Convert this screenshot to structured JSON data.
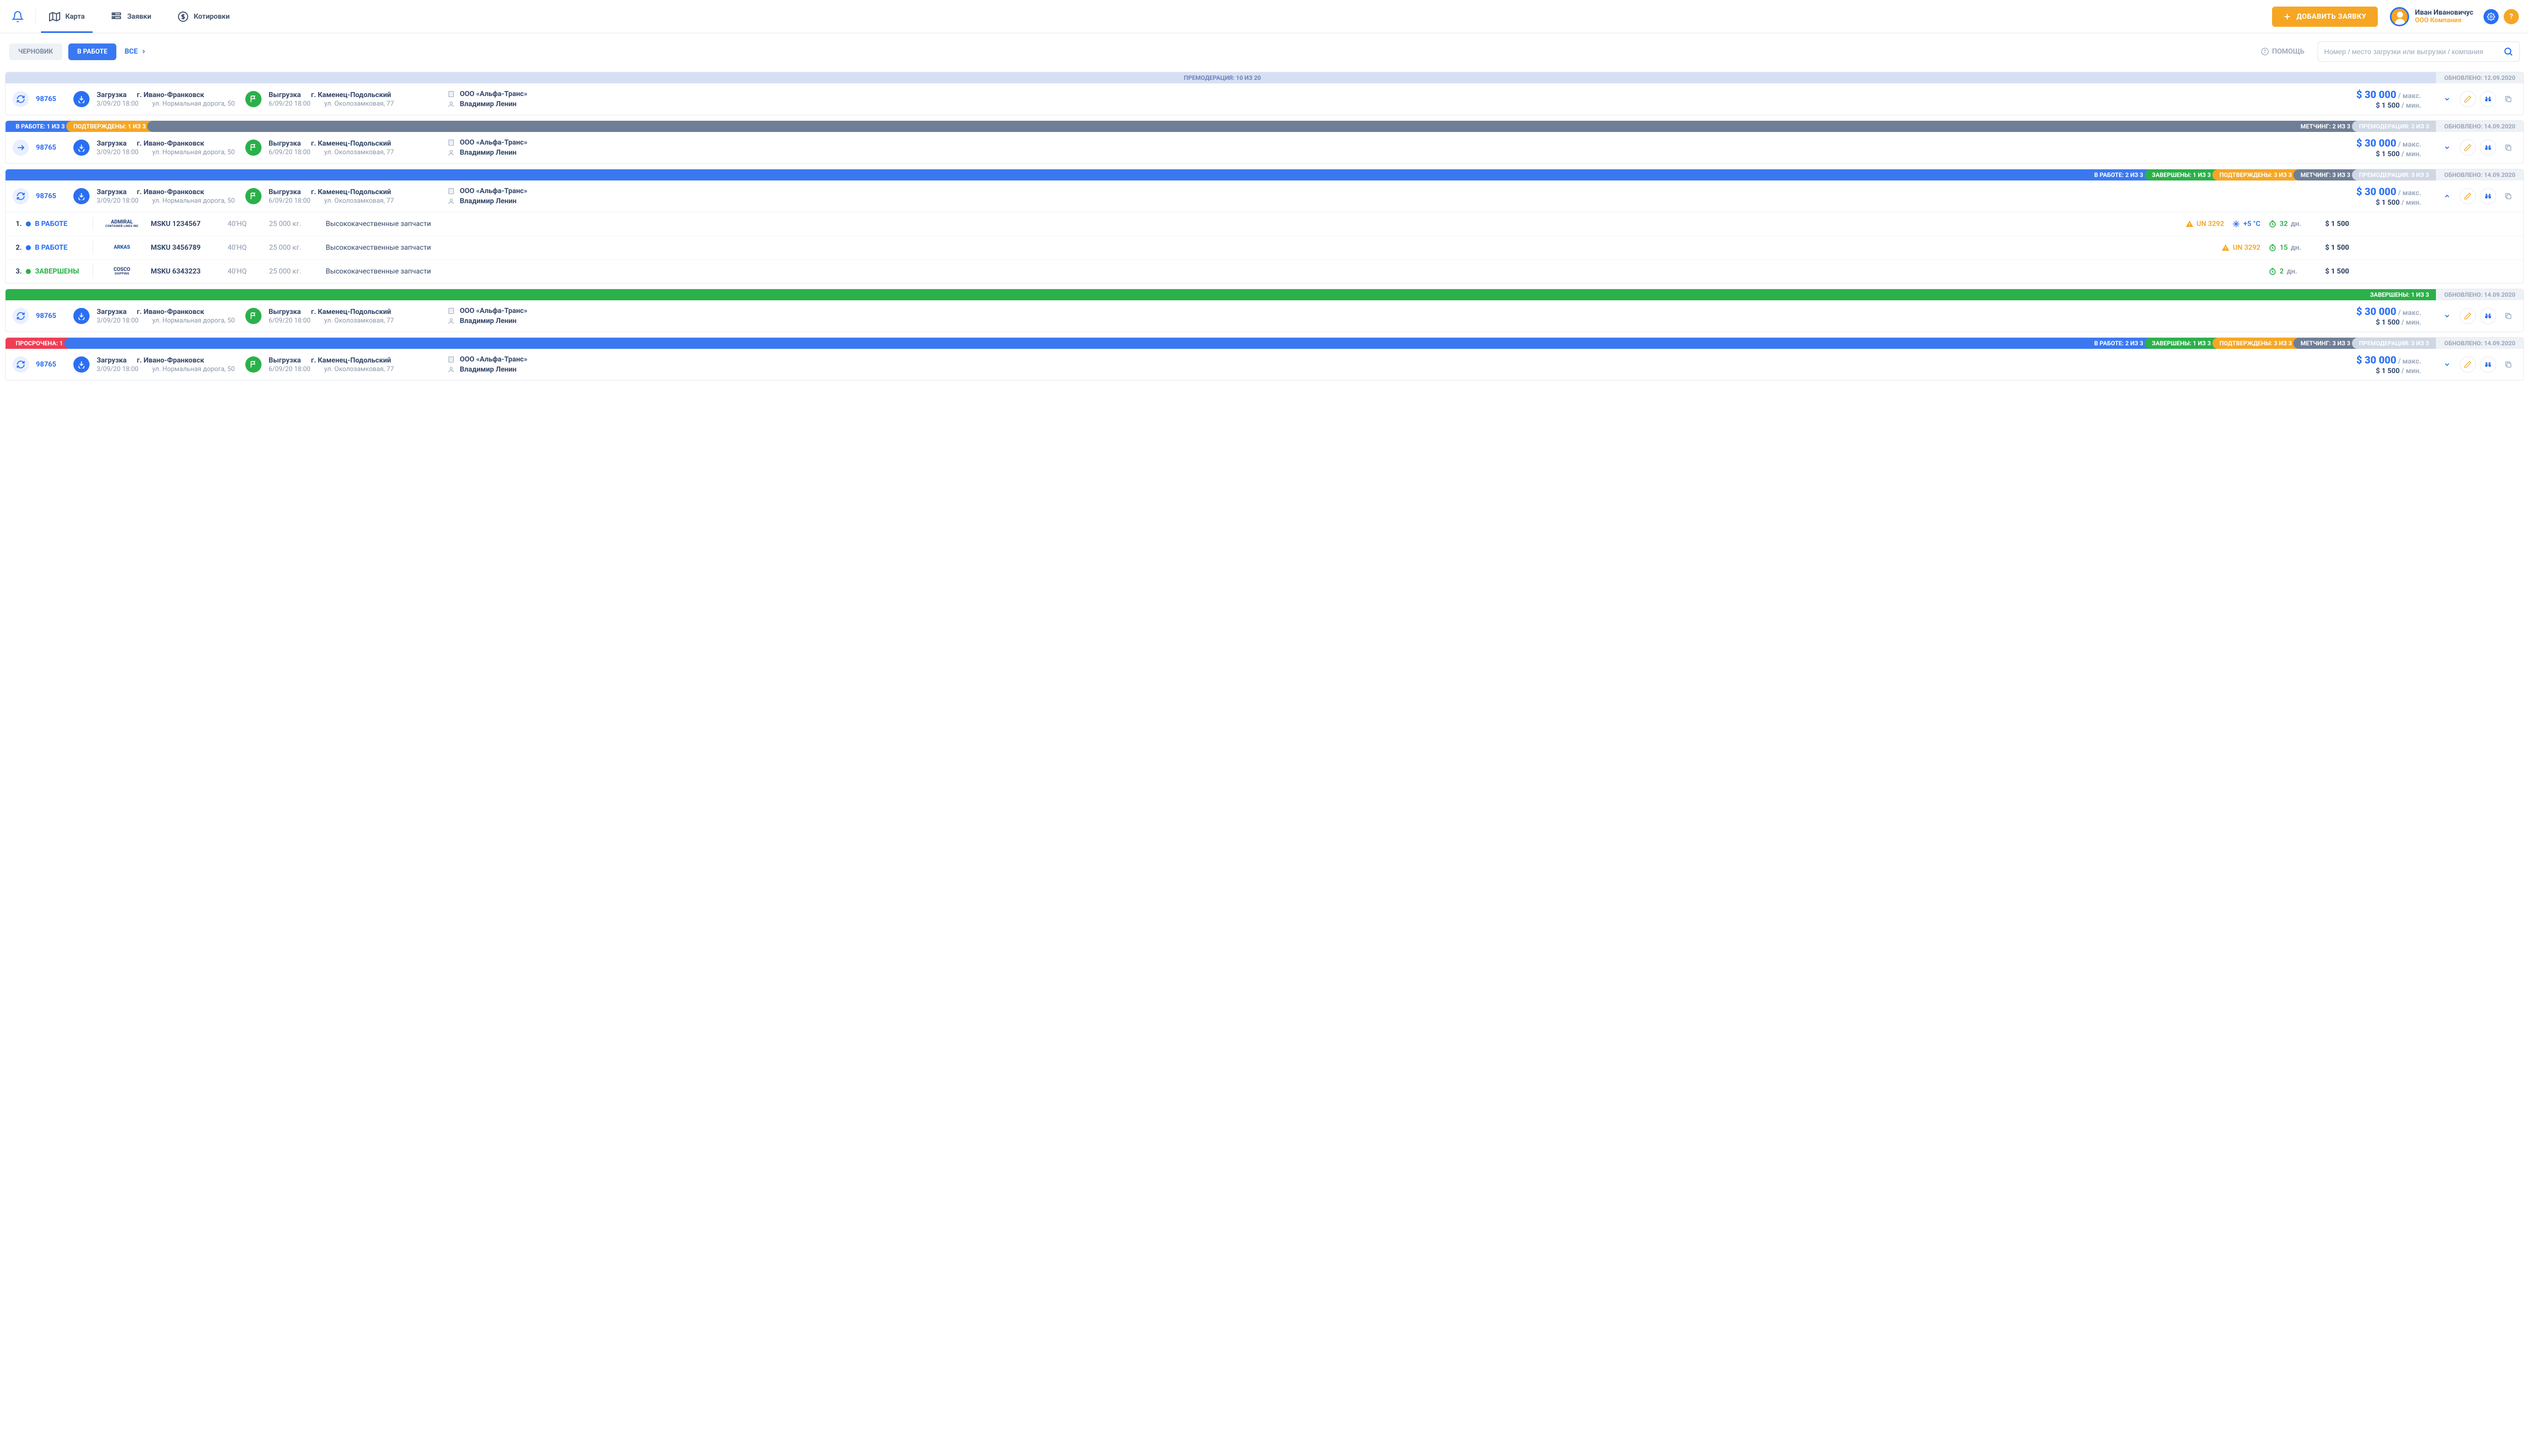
{
  "header": {
    "nav": {
      "map": "Карта",
      "orders": "Заявки",
      "quotes": "Котировки"
    },
    "add_btn": "ДОБАВИТЬ ЗАЯВКУ",
    "user": {
      "name": "Иван Ивановичус",
      "company": "ООО Компания"
    },
    "help_q": "?"
  },
  "filters": {
    "draft": "ЧЕРНОВИК",
    "inwork": "В РАБОТЕ",
    "all": "ВСЕ",
    "help": "ПОМОЩЬ",
    "search_placeholder": "Номер / место загрузки или выгрузки / компания"
  },
  "labels": {
    "load": "Загрузка",
    "unload": "Выгрузка",
    "max": "/ макс.",
    "min": "/ мин.",
    "updated_prefix": "ОБНОВЛЕНО: "
  },
  "common": {
    "id": "98765",
    "load_city": "г. Ивано-Франковск",
    "load_dt": "3/09/20  18:00",
    "load_addr": "ул. Нормальная дорога, 50",
    "unload_city": "г. Каменец-Подольский",
    "unload_dt": "6/09/20  18:00",
    "unload_addr": "ул. Околозамковая, 77",
    "company": "ООО «Альфа-Транс»",
    "person": "Владимир Ленин",
    "price_max": "$ 30 000",
    "price_min": "$ 1 500"
  },
  "rows": [
    {
      "segments": [
        {
          "cls": "c-lav fill center",
          "text": "ПРЕМОДЕРАЦИЯ: 10 ИЗ 20"
        },
        {
          "cls": "updated",
          "text": "ОБНОВЛЕНО: 12.09.2020"
        }
      ],
      "icon": "refresh",
      "expanded": false
    },
    {
      "segments": [
        {
          "cls": "c-blue",
          "text": "В РАБОТЕ: 1 ИЗ 3"
        },
        {
          "cls": "c-orange",
          "text": "ПОДТВЕРЖДЕНЫ: 1 ИЗ 3"
        },
        {
          "cls": "c-dark fill right-text",
          "text": "МЕТЧИНГ: 2 ИЗ 3"
        },
        {
          "cls": "c-gray",
          "text": "ПРЕМОДЕРАЦИЯ: 3 ИЗ 3"
        },
        {
          "cls": "updated",
          "text": "ОБНОВЛЕНО: 14.09.2020"
        }
      ],
      "icon": "arrow",
      "expanded": false
    },
    {
      "segments": [
        {
          "cls": "c-blue fill right-text",
          "text": "В РАБОТЕ: 2 ИЗ 3"
        },
        {
          "cls": "c-green",
          "text": "ЗАВЕРШЕНЫ: 1 ИЗ 3"
        },
        {
          "cls": "c-orange",
          "text": "ПОДТВЕРЖДЕНЫ: 3 ИЗ 3"
        },
        {
          "cls": "c-dark",
          "text": "МЕТЧИНГ: 3 ИЗ 3"
        },
        {
          "cls": "c-gray",
          "text": "ПРЕМОДЕРАЦИЯ: 3 ИЗ 3"
        },
        {
          "cls": "updated",
          "text": "ОБНОВЛЕНО: 14.09.2020"
        }
      ],
      "icon": "refresh",
      "expanded": true
    },
    {
      "segments": [
        {
          "cls": "c-green fill right-text",
          "text": "ЗАВЕРШЕНЫ: 1 ИЗ 3"
        },
        {
          "cls": "updated",
          "text": "ОБНОВЛЕНО: 14.09.2020"
        }
      ],
      "icon": "refresh",
      "expanded": false
    },
    {
      "segments": [
        {
          "cls": "c-red",
          "text": "ПРОСРОЧЕНА: 1"
        },
        {
          "cls": "c-blue fill right-text",
          "text": "В РАБОТЕ: 2 ИЗ 3"
        },
        {
          "cls": "c-green",
          "text": "ЗАВЕРШЕНЫ: 1 ИЗ 3"
        },
        {
          "cls": "c-orange",
          "text": "ПОДТВЕРЖДЕНЫ: 3 ИЗ 3"
        },
        {
          "cls": "c-dark",
          "text": "МЕТЧИНГ: 3 ИЗ 3"
        },
        {
          "cls": "c-gray",
          "text": "ПРЕМОДЕРАЦИЯ: 3 ИЗ 3"
        },
        {
          "cls": "updated",
          "text": "ОБНОВЛЕНО: 14.09.2020"
        }
      ],
      "icon": "refresh",
      "expanded": false
    }
  ],
  "containers": [
    {
      "n": "1.",
      "status": "В РАБОТЕ",
      "scls": "blue",
      "logo": "ADMIRAL",
      "logo_sub": "CONTAINER LINES INC",
      "id": "MSKU 1234567",
      "type": "40'HQ",
      "wt": "25 000 кг.",
      "desc": "Высококачественные запчасти",
      "warn": "UN 3292",
      "temp": "+5 °C",
      "days": "32",
      "days_u": "дн.",
      "price": "$ 1 500"
    },
    {
      "n": "2.",
      "status": "В РАБОТЕ",
      "scls": "blue",
      "logo": "ARKAS",
      "logo_sub": "",
      "id": "MSKU 3456789",
      "type": "40'HQ",
      "wt": "25 000 кг.",
      "desc": "Высококачественные запчасти",
      "warn": "UN 3292",
      "temp": "",
      "days": "15",
      "days_u": "дн.",
      "price": "$ 1 500"
    },
    {
      "n": "3.",
      "status": "ЗАВЕРШЕНЫ",
      "scls": "green",
      "logo": "COSCO",
      "logo_sub": "SHIPPING",
      "id": "MSKU 6343223",
      "type": "40'HQ",
      "wt": "25 000 кг.",
      "desc": "Высококачественные запчасти",
      "warn": "",
      "temp": "",
      "days": "2",
      "days_u": "дн.",
      "price": "$ 1 500"
    }
  ]
}
